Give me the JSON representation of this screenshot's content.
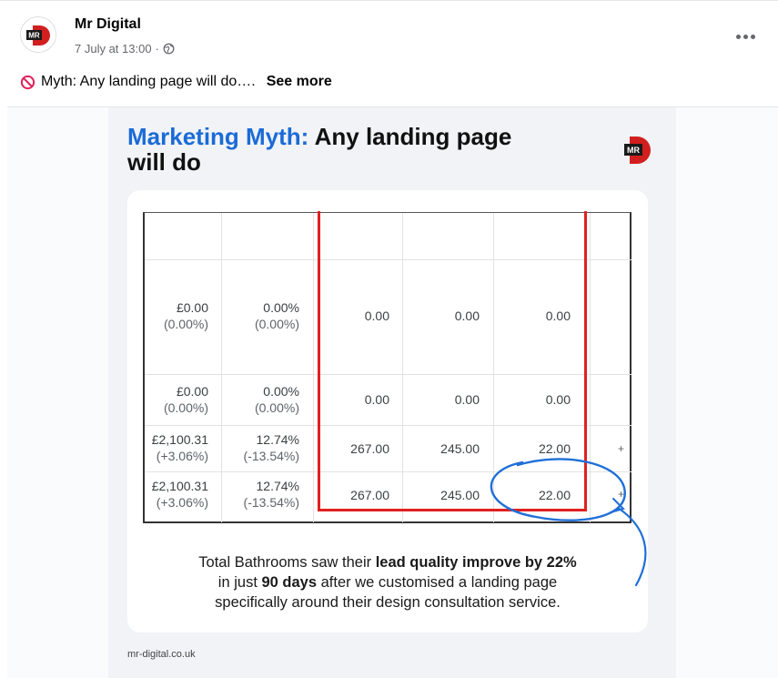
{
  "post": {
    "author": "Mr Digital",
    "timestamp": "7 July at 13:00",
    "separator": "·",
    "privacy_icon": "globe-icon",
    "menu_icon": "more-options-icon",
    "caption_icon": "prohibited-icon",
    "caption_text": "Myth: Any landing page will do….",
    "see_more": "See more"
  },
  "card": {
    "title_blue": "Marketing Myth:",
    "title_rest": "Any landing page",
    "title_line2": "will do",
    "logo_text": "MR",
    "footer_url": "mr-digital.co.uk",
    "description": {
      "p1": "Total Bathrooms saw their ",
      "b1": "lead quality improve by 22%",
      "p2": "in just ",
      "b2": "90 days",
      "p3": " after we customised a landing page",
      "p4": "specifically around their design consultation service."
    }
  },
  "table": {
    "rows": [
      {
        "c1": "£0.00",
        "c1s": "(0.00%)",
        "c2": "0.00%",
        "c2s": "(0.00%)",
        "c3": "0.00",
        "c4": "0.00",
        "c5": "0.00",
        "c6": ""
      },
      {
        "c1": "£0.00",
        "c1s": "(0.00%)",
        "c2": "0.00%",
        "c2s": "(0.00%)",
        "c3": "0.00",
        "c4": "0.00",
        "c5": "0.00",
        "c6": ""
      },
      {
        "c1": "£2,100.31",
        "c1s": "(+3.06%)",
        "c2": "12.74%",
        "c2s": "(-13.54%)",
        "c3": "267.00",
        "c4": "245.00",
        "c5": "22.00",
        "c6": "+"
      },
      {
        "c1": "£2,100.31",
        "c1s": "(+3.06%)",
        "c2": "12.74%",
        "c2s": "(-13.54%)",
        "c3": "267.00",
        "c4": "245.00",
        "c5": "22.00",
        "c6": "+"
      }
    ]
  },
  "colors": {
    "accent_blue": "#1a6bd6",
    "highlight_red": "#e02020",
    "brand_red": "#d11f1f",
    "annotation_blue": "#1f6fd8"
  }
}
